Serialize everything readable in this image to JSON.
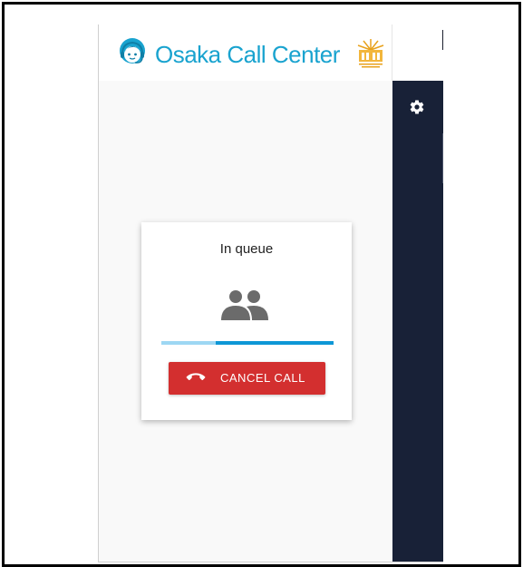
{
  "header": {
    "brand": "Osaka Call Center",
    "mascot_icon": "headset-agent-icon",
    "seal_icon": "osaka-seal-icon"
  },
  "sidebar": {
    "settings_icon": "gear-icon"
  },
  "card": {
    "title": "In queue",
    "people_icon": "people-icon",
    "progress_fraction": 0.68,
    "cancel_label": "CANCEL CALL",
    "cancel_icon": "hang-up-phone-icon"
  },
  "colors": {
    "brand": "#19a3cf",
    "sidebar": "#182137",
    "progress_track": "#9dd7f3",
    "progress_fill": "#0d97d6",
    "cancel_button": "#d32f2f"
  }
}
